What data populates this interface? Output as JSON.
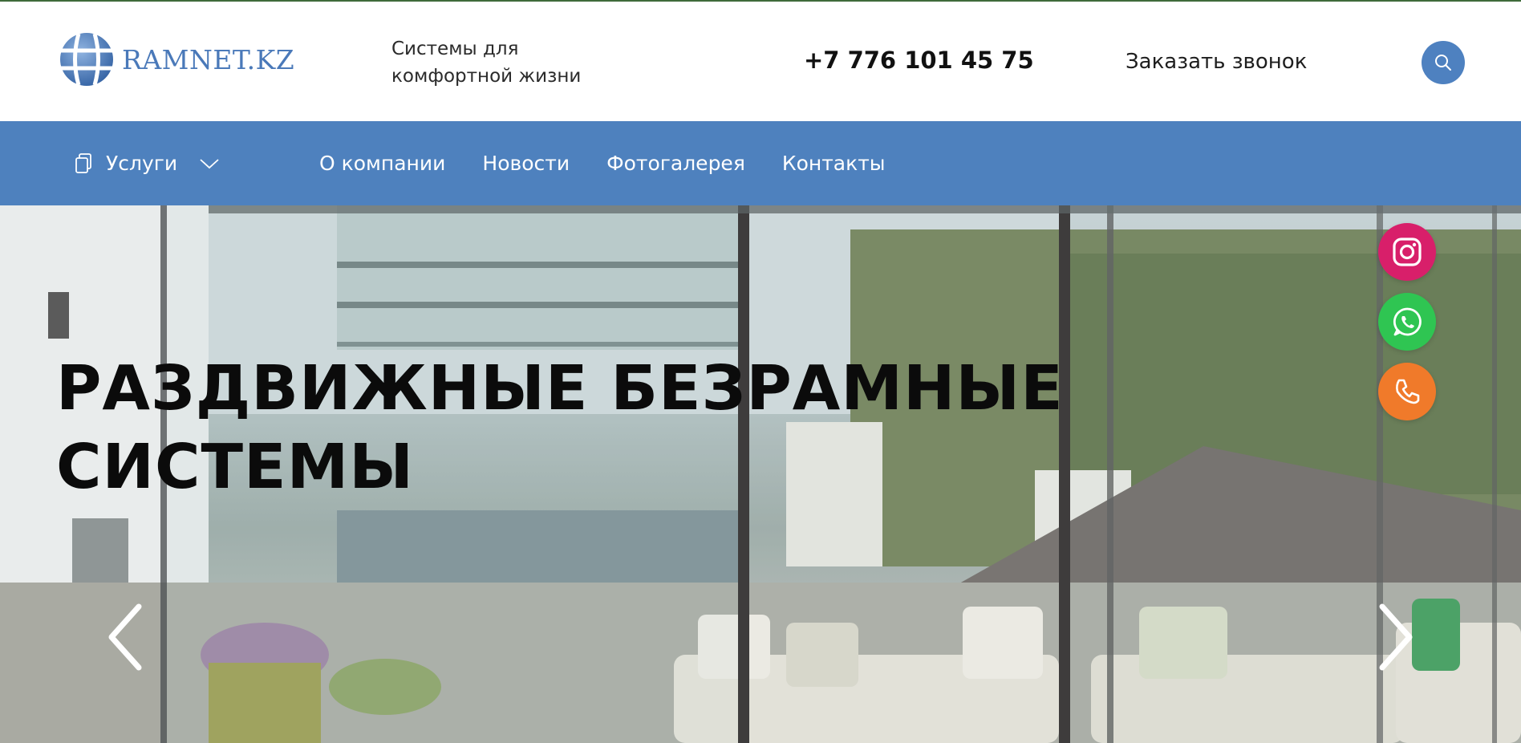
{
  "header": {
    "logo_text": "RAMNET.KZ",
    "tagline": "Системы для комфортной жизни",
    "phone": "+7 776 101 45 75",
    "callback_label": "Заказать звонок",
    "search_icon": "search-icon"
  },
  "nav": {
    "services_label": "Услуги",
    "services_icon": "copy-icon",
    "links": [
      {
        "label": "О компании"
      },
      {
        "label": "Новости"
      },
      {
        "label": "Фотогалерея"
      },
      {
        "label": "Контакты"
      }
    ]
  },
  "hero": {
    "title_line1": "РАЗДВИЖНЫЕ БЕЗРАМНЫЕ",
    "title_line2": "СИСТЕМЫ",
    "prev_icon": "chevron-left-icon",
    "next_icon": "chevron-right-icon"
  },
  "social": {
    "instagram_icon": "instagram-icon",
    "whatsapp_icon": "whatsapp-icon",
    "phone_icon": "phone-icon"
  },
  "colors": {
    "brand_blue": "#4e81be",
    "instagram": "#d81f6a",
    "whatsapp": "#2fc552",
    "phone": "#f07a2a"
  }
}
